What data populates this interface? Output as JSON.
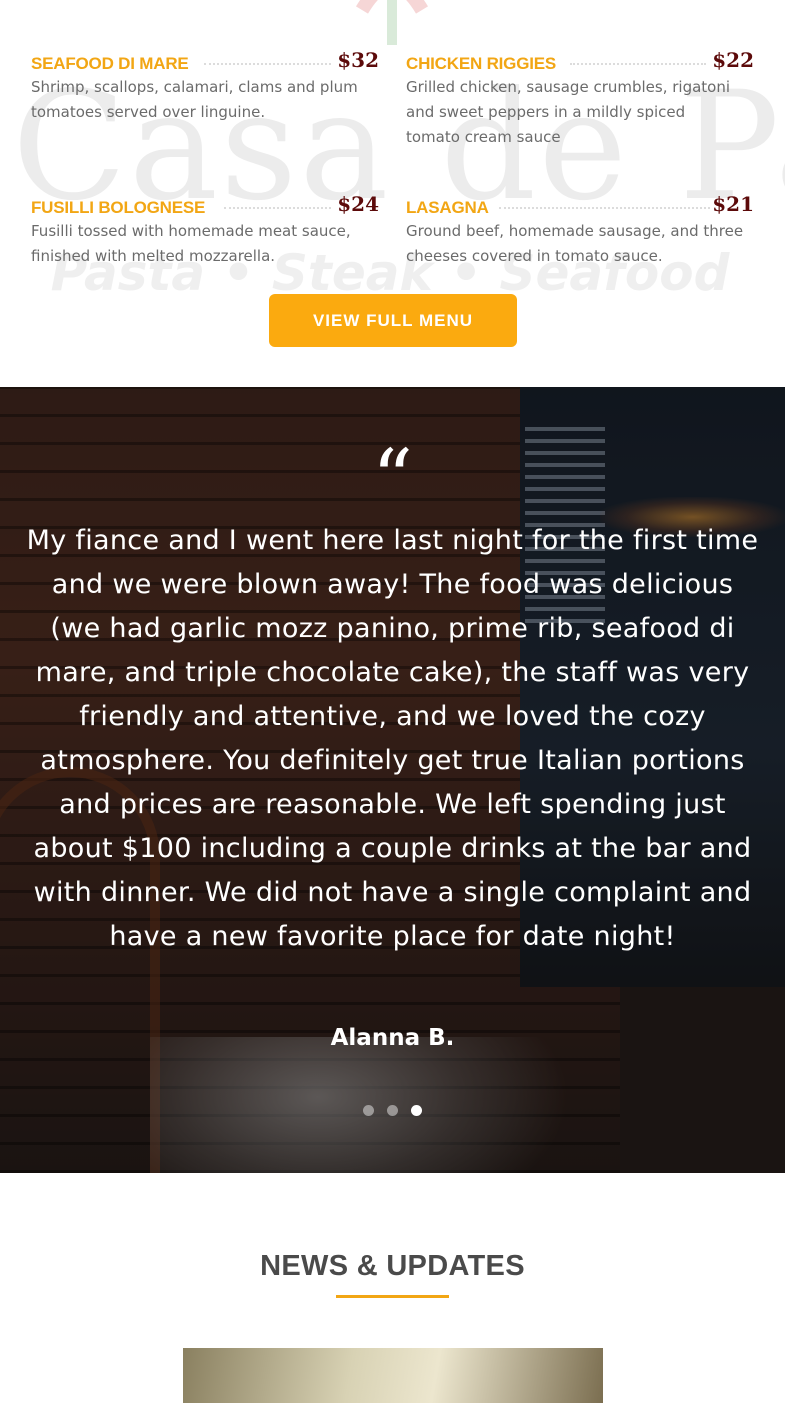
{
  "watermark": {
    "brand": "Casa de Pasta",
    "tagline": "Pasta • Steak • Seafood"
  },
  "menu": {
    "items": [
      {
        "name": "SEAFOOD DI MARE",
        "price": "$32",
        "description": "Shrimp, scallops, calamari, clams and plum tomatoes served over linguine."
      },
      {
        "name": "CHICKEN RIGGIES",
        "price": "$22",
        "description": "Grilled chicken, sausage crumbles, rigatoni and sweet peppers in a mildly spiced tomato cream sauce"
      },
      {
        "name": "FUSILLI BOLOGNESE",
        "price": "$24",
        "description": "Fusilli tossed with homemade meat sauce, finished with melted mozzarella."
      },
      {
        "name": "LASAGNA",
        "price": "$21",
        "description": "Ground beef, homemade sausage, and three cheeses covered in tomato sauce."
      }
    ],
    "view_full_menu_label": "VIEW FULL MENU"
  },
  "testimonial": {
    "quote_mark": "“",
    "text": "My fiance and I went here last night for the first time and we were blown away! The food was delicious (we had garlic mozz panino, prime rib, seafood di mare, and triple chocolate cake), the staff was very friendly and attentive, and we loved the cozy atmosphere. You definitely get true Italian portions and prices are reasonable. We left spending just about $100 including a couple drinks at the bar and with dinner. We did not have a single complaint and have a new favorite place for date night!",
    "author": "Alanna B.",
    "slides_total": 3,
    "active_slide": 3
  },
  "news": {
    "title": "NEWS & UPDATES"
  },
  "colors": {
    "accent": "#f2a614",
    "button": "#fbaa0f",
    "price": "#5c0a0a",
    "heading": "#4a4a4a"
  }
}
